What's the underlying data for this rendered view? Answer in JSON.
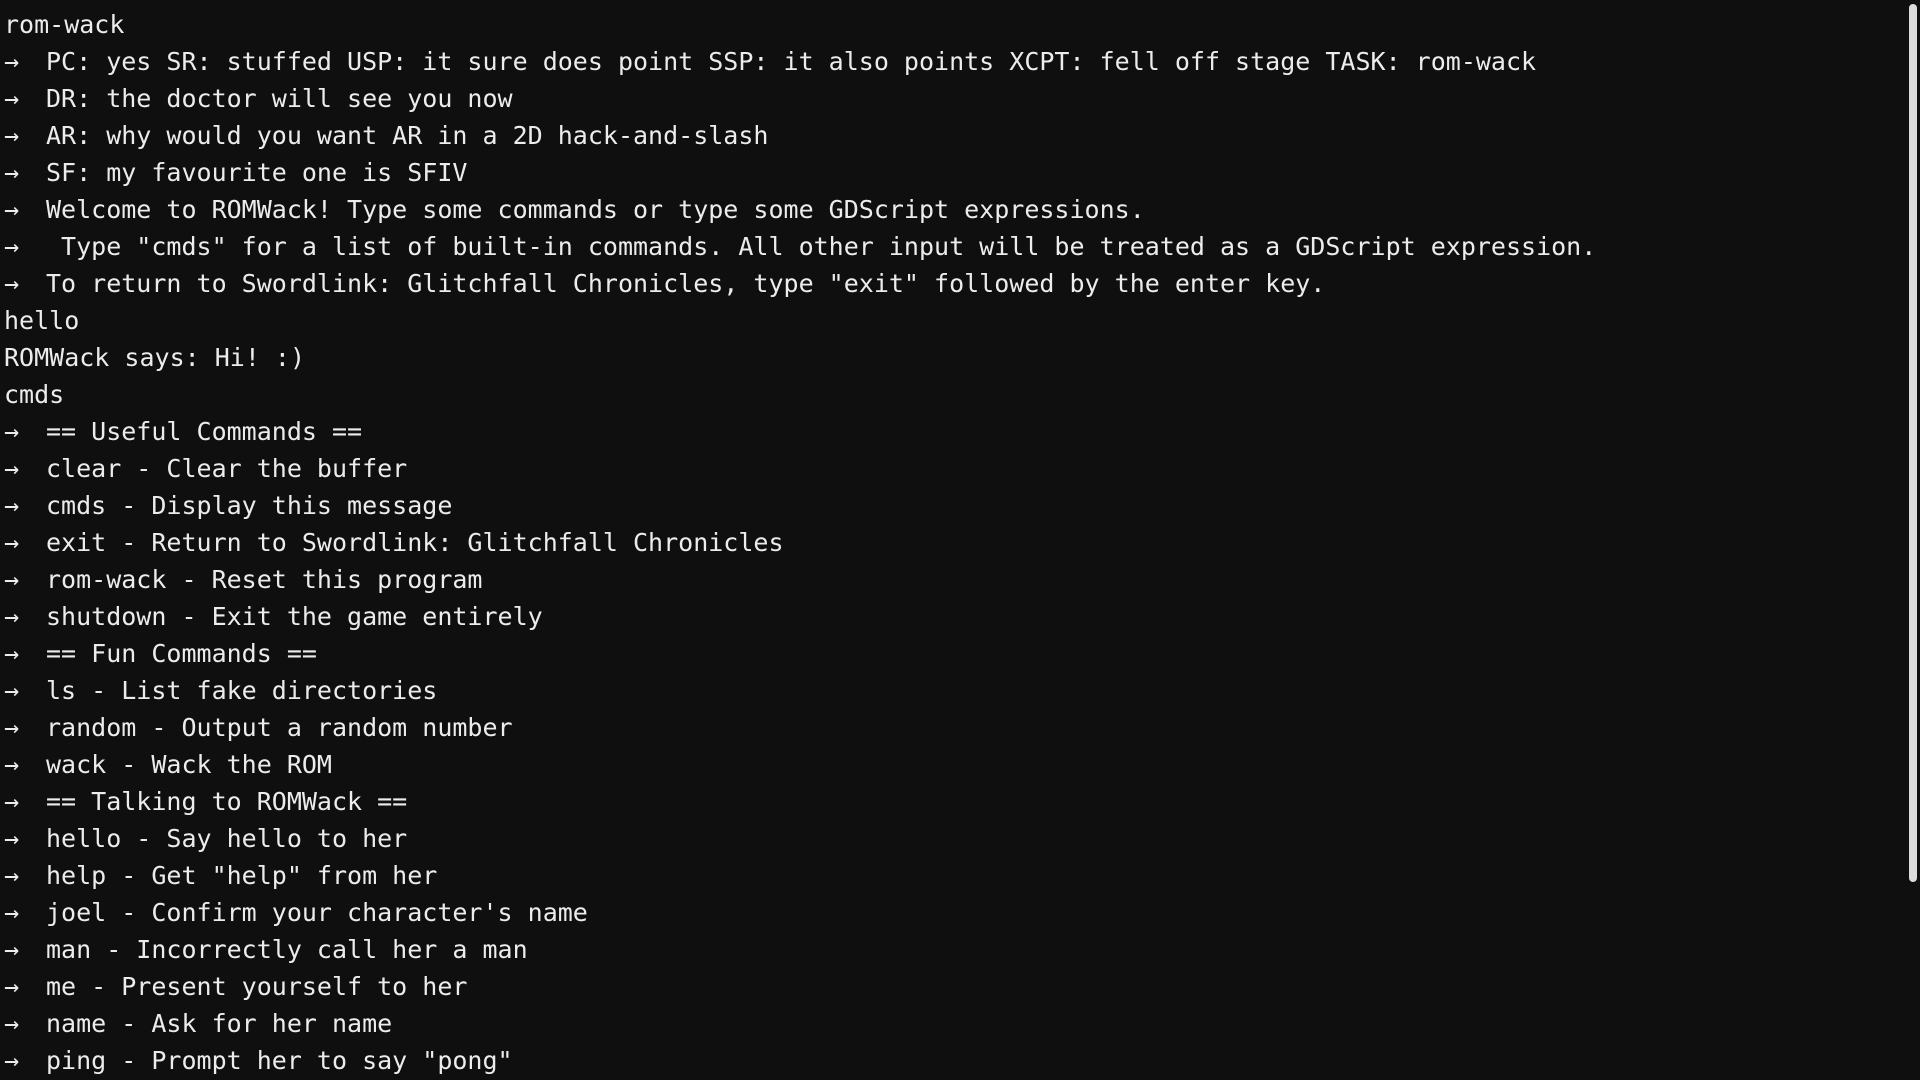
{
  "terminal": {
    "arrow": "→",
    "lines": [
      {
        "prefix": "",
        "text": "rom-wack"
      },
      {
        "prefix": "→",
        "text": "PC: yes SR: stuffed USP: it sure does point SSP: it also points XCPT: fell off stage TASK: rom-wack"
      },
      {
        "prefix": "→",
        "text": "DR: the doctor will see you now"
      },
      {
        "prefix": "→",
        "text": "AR: why would you want AR in a 2D hack-and-slash"
      },
      {
        "prefix": "→",
        "text": "SF: my favourite one is SFIV"
      },
      {
        "prefix": "→",
        "text": "Welcome to ROMWack! Type some commands or type some GDScript expressions."
      },
      {
        "prefix": "→",
        "text": " Type \"cmds\" for a list of built-in commands. All other input will be treated as a GDScript expression."
      },
      {
        "prefix": "→",
        "text": "To return to Swordlink: Glitchfall Chronicles, type \"exit\" followed by the enter key."
      },
      {
        "prefix": "",
        "text": "hello"
      },
      {
        "prefix": "",
        "text": "ROMWack says: Hi! :)"
      },
      {
        "prefix": "",
        "text": "cmds"
      },
      {
        "prefix": "→",
        "text": "== Useful Commands =="
      },
      {
        "prefix": "→",
        "text": "clear - Clear the buffer"
      },
      {
        "prefix": "→",
        "text": "cmds - Display this message"
      },
      {
        "prefix": "→",
        "text": "exit - Return to Swordlink: Glitchfall Chronicles"
      },
      {
        "prefix": "→",
        "text": "rom-wack - Reset this program"
      },
      {
        "prefix": "→",
        "text": "shutdown - Exit the game entirely"
      },
      {
        "prefix": "→",
        "text": "== Fun Commands =="
      },
      {
        "prefix": "→",
        "text": "ls - List fake directories"
      },
      {
        "prefix": "→",
        "text": "random - Output a random number"
      },
      {
        "prefix": "→",
        "text": "wack - Wack the ROM"
      },
      {
        "prefix": "→",
        "text": "== Talking to ROMWack =="
      },
      {
        "prefix": "→",
        "text": "hello - Say hello to her"
      },
      {
        "prefix": "→",
        "text": "help - Get \"help\" from her"
      },
      {
        "prefix": "→",
        "text": "joel - Confirm your character's name"
      },
      {
        "prefix": "→",
        "text": "man - Incorrectly call her a man"
      },
      {
        "prefix": "→",
        "text": "me - Present yourself to her"
      },
      {
        "prefix": "→",
        "text": "name - Ask for her name"
      },
      {
        "prefix": "→",
        "text": "ping - Prompt her to say \"pong\""
      }
    ]
  },
  "colors": {
    "background": "#0f0f0f",
    "text": "#ececec",
    "scrollbar_thumb": "#dcdcdc"
  }
}
